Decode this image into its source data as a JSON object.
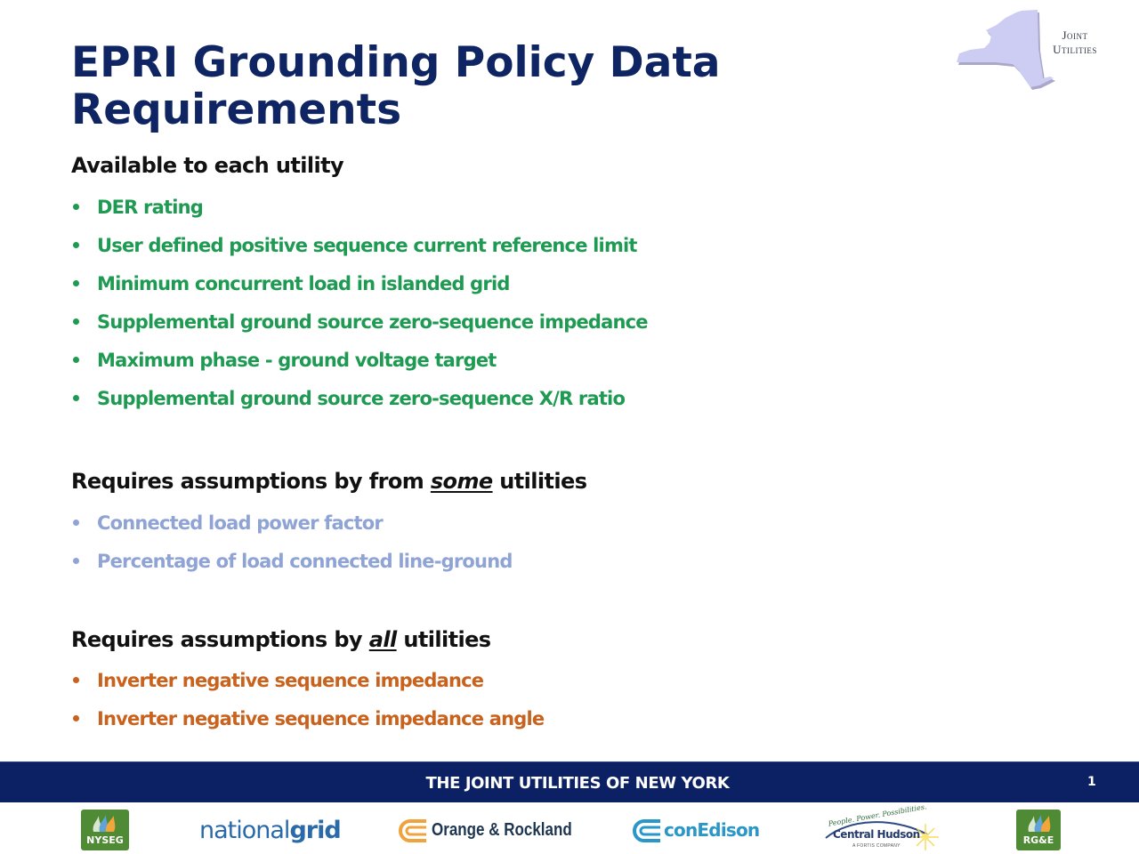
{
  "slide": {
    "title": "EPRI Grounding Policy Data Requirements",
    "page_number": "1"
  },
  "header_logo": {
    "name": "Joint Utilities",
    "line1": "Joint",
    "line2": "Utilities",
    "icon": "new-york-state-map-icon"
  },
  "sections": [
    {
      "heading_pre": "Available to each utility",
      "heading_em": "",
      "heading_post": "",
      "color": "#1e9a52",
      "items": [
        "DER rating",
        "User defined positive sequence current reference limit",
        "Minimum concurrent load in islanded grid",
        "Supplemental ground source zero-sequence impedance",
        "Maximum phase - ground voltage target",
        "Supplemental ground source zero-sequence X/R ratio"
      ]
    },
    {
      "heading_pre": "Requires assumptions by from ",
      "heading_em": "some",
      "heading_post": " utilities",
      "color": "#8fa4d4",
      "items": [
        "Connected load power factor",
        "Percentage of load connected line-ground"
      ]
    },
    {
      "heading_pre": "Requires assumptions by ",
      "heading_em": "all",
      "heading_post": " utilities",
      "color": "#c8621d",
      "items": [
        "Inverter negative sequence impedance",
        "Inverter negative sequence impedance angle"
      ]
    }
  ],
  "footer": {
    "band_text": "THE JOINT UTILITIES OF NEW YORK",
    "band_color": "#0b2163",
    "logos": [
      {
        "name": "NYSEG",
        "label": "NYSEG"
      },
      {
        "name": "National Grid",
        "label_light": "national",
        "label_bold": "grid"
      },
      {
        "name": "Orange & Rockland",
        "label": "Orange & Rockland"
      },
      {
        "name": "Con Edison",
        "label": "conEdison"
      },
      {
        "name": "Central Hudson",
        "tagline": "People. Power. Possibilities.",
        "label": "Central Hudson",
        "sublabel": "A FORTIS COMPANY"
      },
      {
        "name": "RG&E",
        "label": "RG&E"
      }
    ]
  }
}
